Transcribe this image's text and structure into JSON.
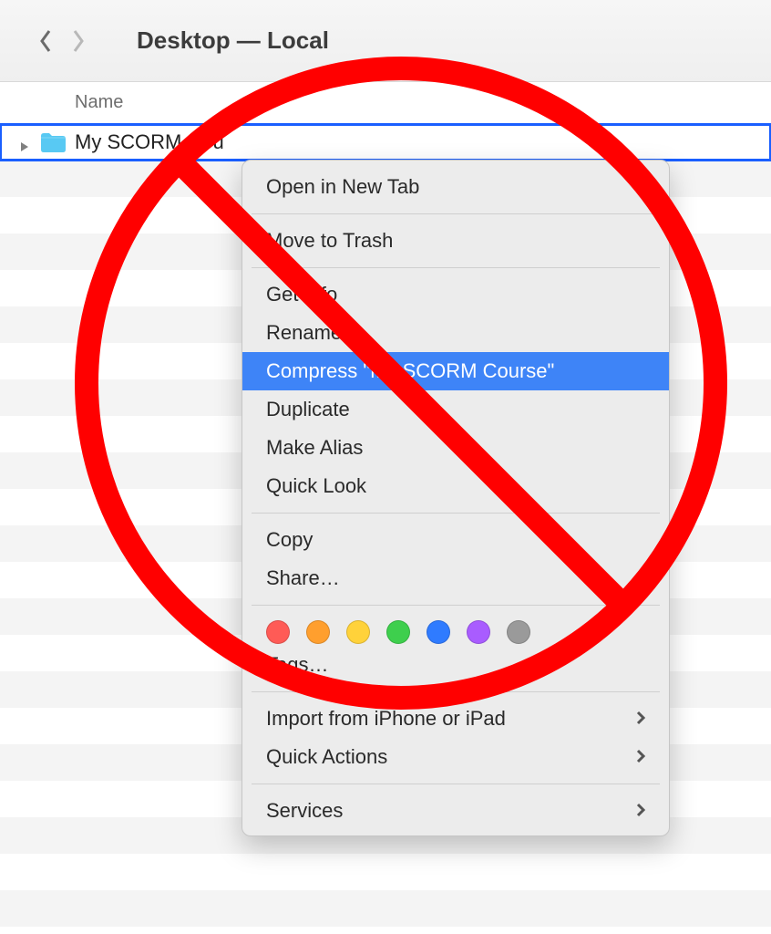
{
  "toolbar": {
    "title": "Desktop — Local"
  },
  "columns": {
    "name_label": "Name"
  },
  "file": {
    "name": "My SCORM Cou"
  },
  "menu": {
    "open_new_tab": "Open in New Tab",
    "move_to_trash": "Move to Trash",
    "get_info": "Get Info",
    "rename": "Rename",
    "compress": "Compress \"My SCORM Course\"",
    "duplicate": "Duplicate",
    "make_alias": "Make Alias",
    "quick_look": "Quick Look",
    "copy": "Copy",
    "share": "Share…",
    "tags": "Tags…",
    "import": "Import from iPhone or iPad",
    "quick_actions": "Quick Actions",
    "services": "Services"
  },
  "tag_colors": [
    "#ff5b56",
    "#ff9f2e",
    "#ffd23a",
    "#3ecf4d",
    "#2f7bff",
    "#a95cff",
    "#9a9a9a"
  ]
}
